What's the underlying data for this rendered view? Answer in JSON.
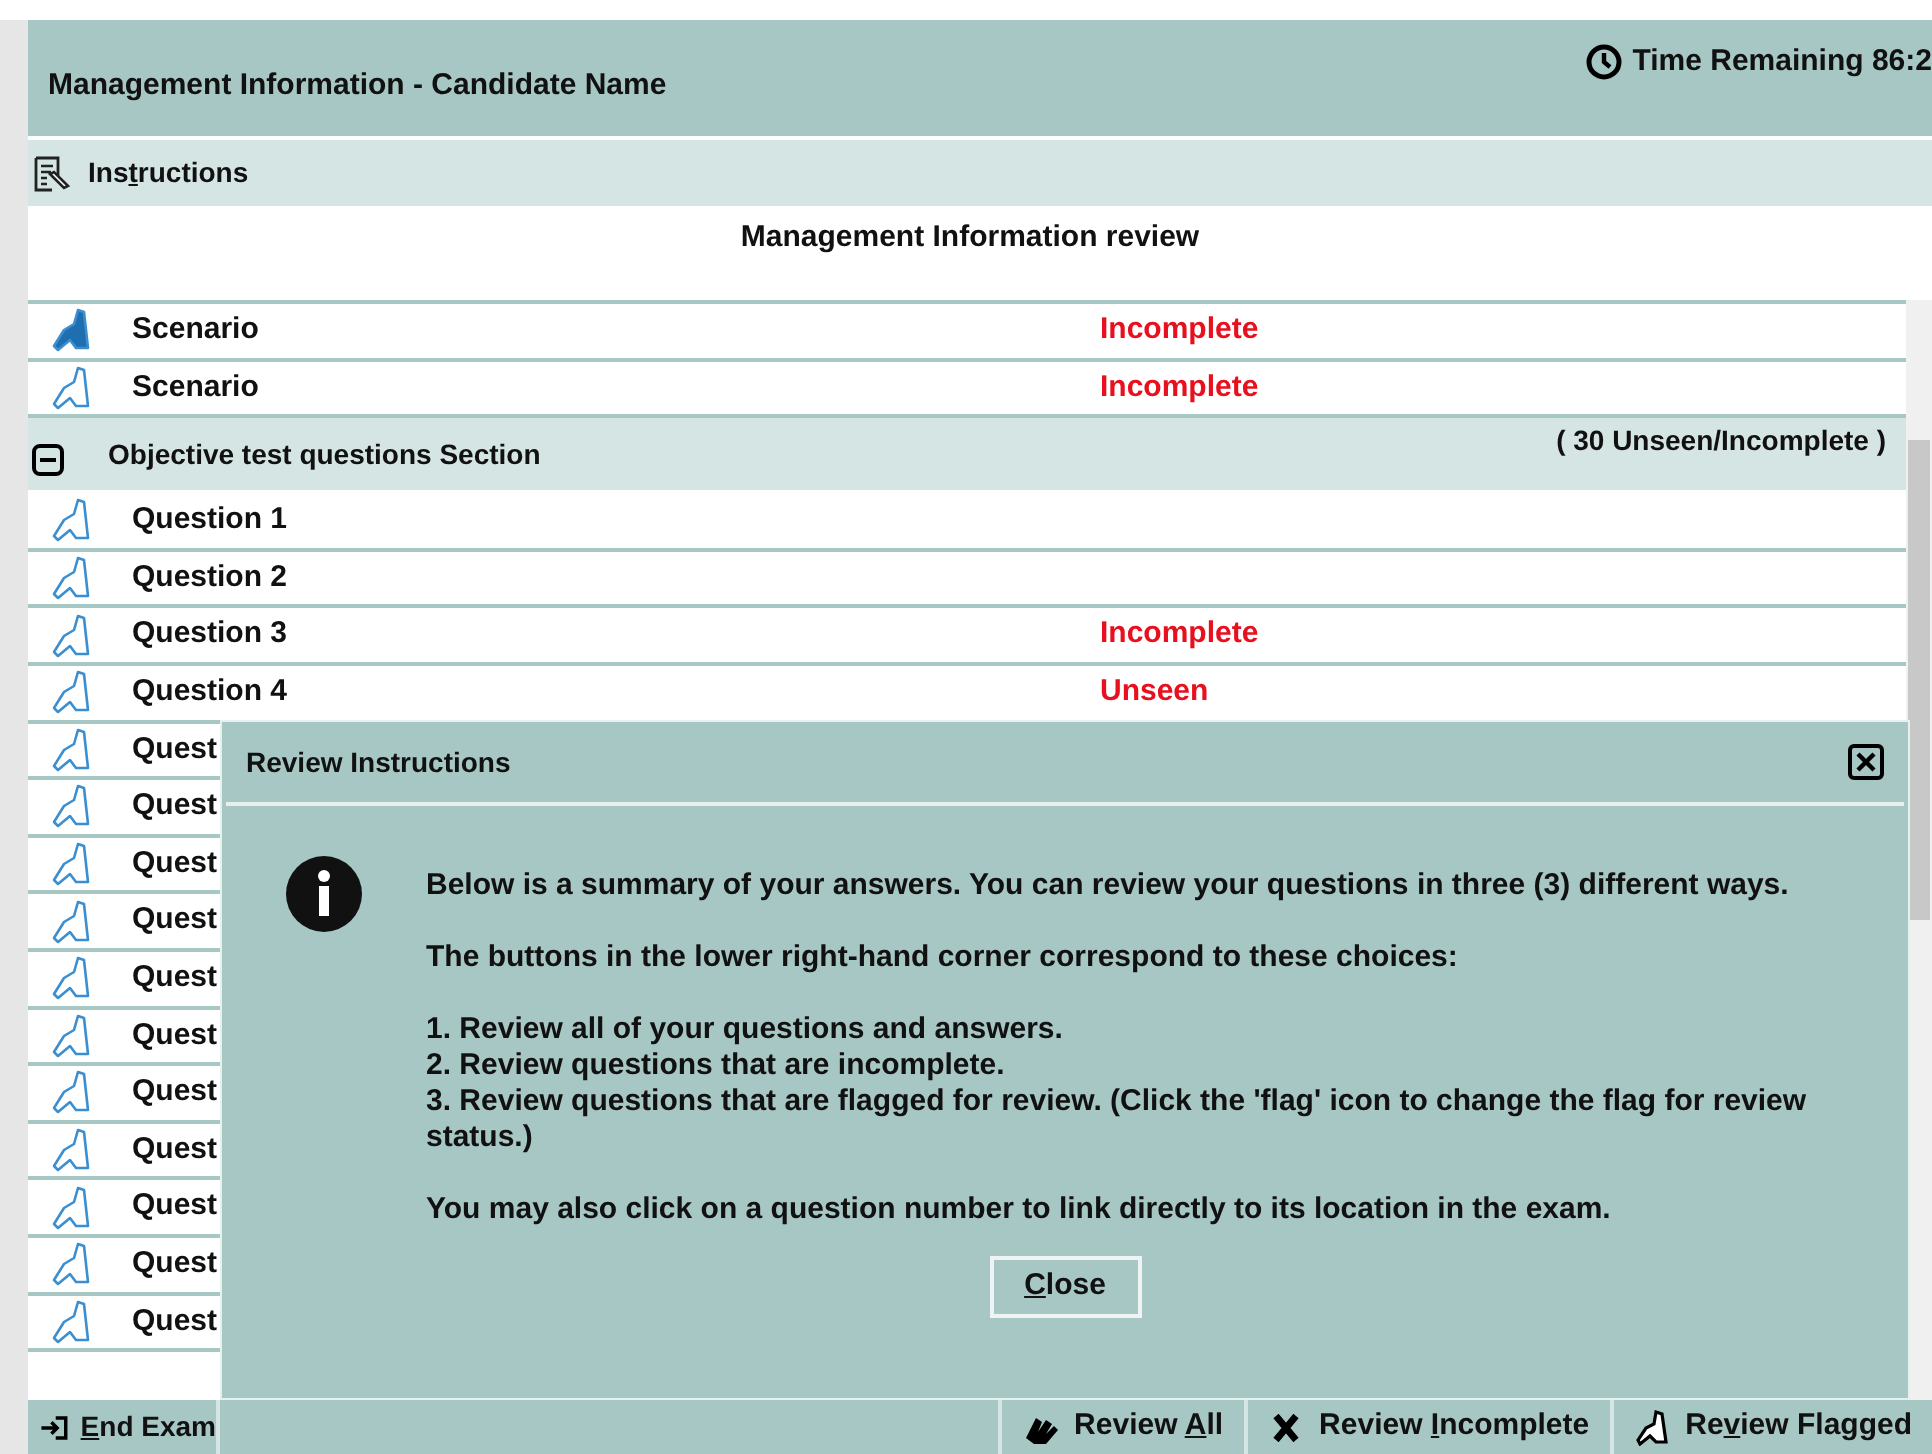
{
  "header": {
    "title": "Management Information - Candidate Name",
    "timer": "Time Remaining 86:2"
  },
  "instructions_bar": {
    "label": {
      "before": "Ins",
      "key": "t",
      "after": "ructions"
    }
  },
  "review_title": "Management Information review",
  "items": [
    {
      "kind": "item",
      "label": "Scenario",
      "status": "Incomplete",
      "flagged": true
    },
    {
      "kind": "item",
      "label": "Scenario",
      "status": "Incomplete",
      "flagged": false
    },
    {
      "kind": "section",
      "label": "Objective test questions Section",
      "summary": "( 30 Unseen/Incomplete )",
      "expanded": true
    },
    {
      "kind": "item",
      "label": "Question 1",
      "flagged": false
    },
    {
      "kind": "item",
      "label": "Question 2",
      "flagged": false
    },
    {
      "kind": "item",
      "label": "Question 3",
      "status": "Incomplete",
      "flagged": false
    },
    {
      "kind": "item",
      "label": "Question 4",
      "status": "Unseen",
      "flagged": false
    },
    {
      "kind": "item",
      "label": "Quest",
      "flagged": false
    },
    {
      "kind": "item",
      "label": "Quest",
      "flagged": false
    },
    {
      "kind": "item",
      "label": "Quest",
      "flagged": false
    },
    {
      "kind": "item",
      "label": "Quest",
      "flagged": false
    },
    {
      "kind": "item",
      "label": "Quest",
      "flagged": false
    },
    {
      "kind": "item",
      "label": "Quest",
      "flagged": false
    },
    {
      "kind": "item",
      "label": "Quest",
      "flagged": false
    },
    {
      "kind": "item",
      "label": "Quest",
      "flagged": false
    },
    {
      "kind": "item",
      "label": "Quest",
      "flagged": false
    },
    {
      "kind": "item",
      "label": "Quest",
      "flagged": false
    },
    {
      "kind": "item",
      "label": "Quest",
      "flagged": false
    }
  ],
  "dialog": {
    "title": "Review Instructions",
    "paragraphs": [
      {
        "kind": "para",
        "text": "Below is a summary of your answers. You can review your questions in three (3) different ways."
      },
      {
        "kind": "para",
        "text": "The buttons in the lower right-hand corner correspond to these choices:"
      },
      {
        "kind": "list",
        "lines": [
          "1. Review all of your questions and answers.",
          "2. Review questions that are incomplete.",
          "3. Review questions that are flagged for review. (Click the 'flag' icon to change the flag for review status.)"
        ]
      },
      {
        "kind": "para",
        "text": "You may also click on a question number to link directly to its location in the exam."
      }
    ],
    "button": {
      "key": "C",
      "after": "lose"
    }
  },
  "footer": {
    "end_exam": {
      "key": "E",
      "after": "nd Exam"
    },
    "buttons": [
      {
        "kind": "all",
        "label": {
          "before": "Review ",
          "key": "A",
          "after": "ll"
        }
      },
      {
        "kind": "incomplete",
        "label": {
          "before": "Review ",
          "key": "I",
          "after": "ncomplete"
        }
      },
      {
        "kind": "flagged",
        "label": {
          "before": "Re",
          "key": "v",
          "after": "iew Flagged"
        }
      }
    ]
  }
}
